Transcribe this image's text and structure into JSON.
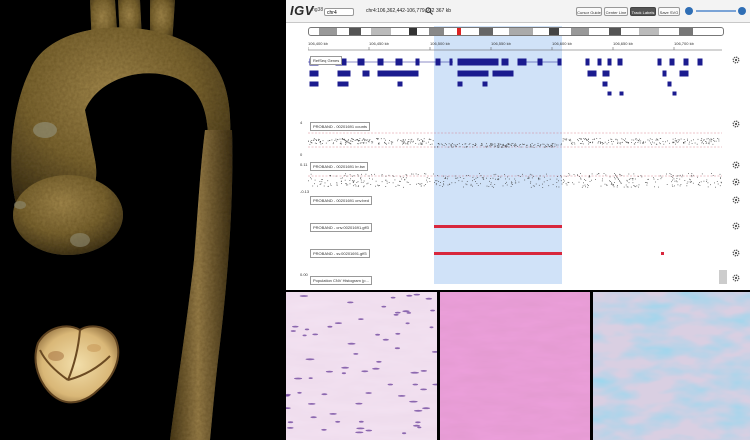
{
  "igv": {
    "logo": "IGV",
    "genome": "hg38",
    "chromosome": "chr4",
    "locus": "chr4:106,362,442-106,779,932",
    "width": "367 kb",
    "buttons": {
      "cursor_guide": "Cursor Guide",
      "center_line": "Center Line",
      "track_labels": "Track Labels",
      "save_svg": "Save SVG"
    },
    "ruler_ticks": [
      "106,400 kb",
      "106,450 kb",
      "106,500 kb",
      "106,550 kb",
      "106,600 kb",
      "106,650 kb",
      "106,700 kb",
      "106,750 kb"
    ],
    "tracks": {
      "refseq": "RefSeq Genes",
      "counts": "PROBAND - 00201691 counts",
      "lr": "PROBAND - 00201691 lrr.bw",
      "cnv_bed": "PROBAND - 00201691 cnv.bed",
      "cnv_gff": "PROBAND - cnv.00201691.gff3",
      "sv_gff": "PROBAND - sv.00201691.gff3",
      "population": "Population CNV Histogram (p..."
    },
    "axis_labels": {
      "counts_top": "4",
      "counts_bottom": "0",
      "lr_top": "0.11",
      "lr_bottom": "-0.13",
      "pop_top": "0.00"
    },
    "colors": {
      "region_highlight": "#a9c8f0",
      "cnv_red": "#d8273d",
      "gene_blue": "#1b1b8f"
    }
  },
  "images": {
    "ct": "aorta-3d-ct-render",
    "valve": "excised-aortic-valve",
    "histo1": "he-stain-light",
    "histo2": "he-stain-dense",
    "histo3": "alcian-blue-stain"
  }
}
